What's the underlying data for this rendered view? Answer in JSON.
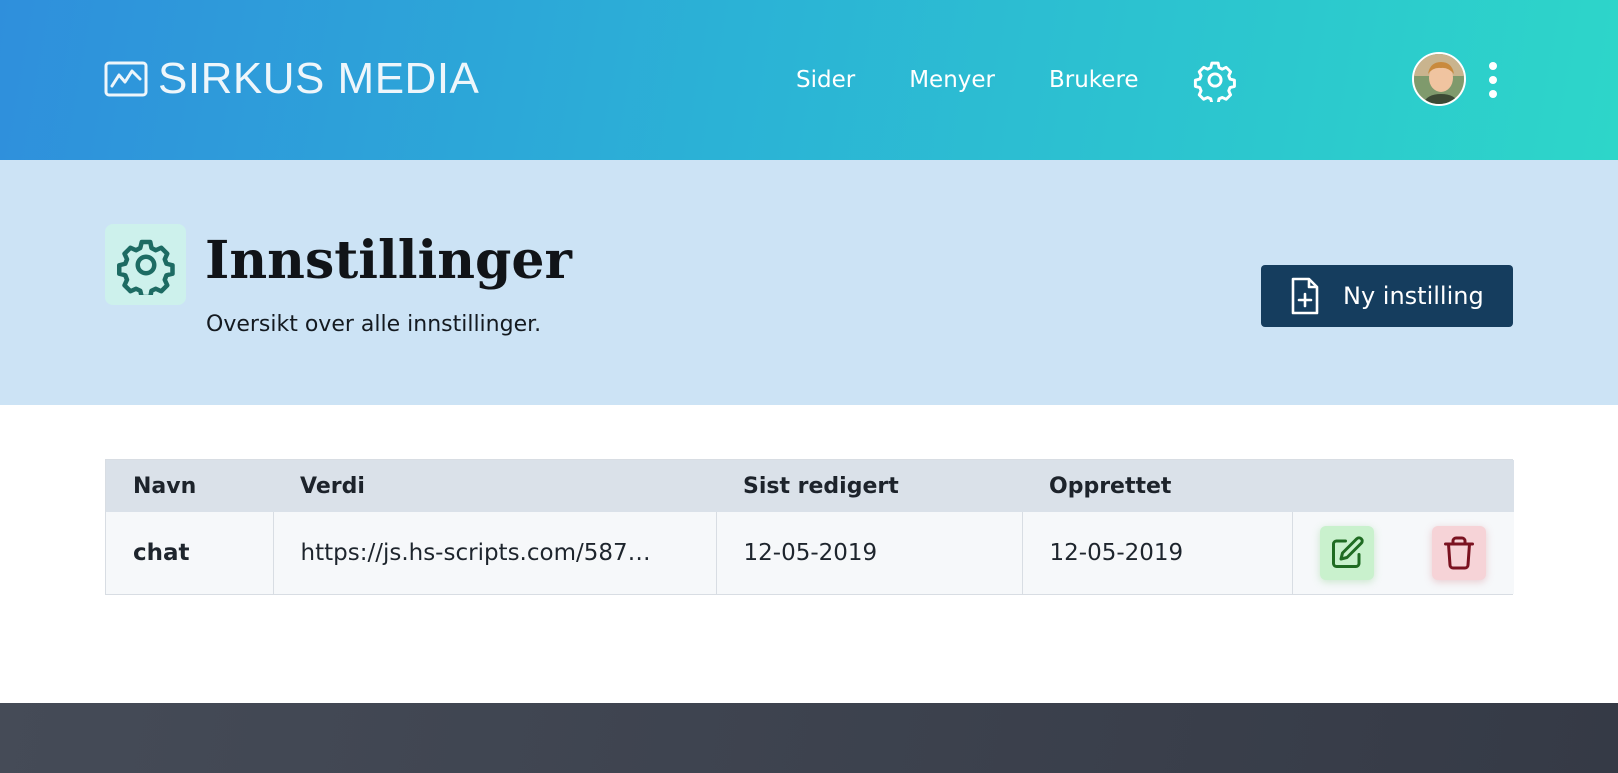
{
  "header": {
    "brand": "SIRKUS MEDIA",
    "logo_icon": "chart-line-icon",
    "nav": [
      {
        "label": "Sider"
      },
      {
        "label": "Menyer"
      },
      {
        "label": "Brukere"
      }
    ],
    "settings_icon": "gear-icon",
    "menu_icon": "kebab-menu-icon"
  },
  "hero": {
    "icon": "gear-icon",
    "title": "Innstillinger",
    "subtitle": "Oversikt over alle innstillinger.",
    "new_button_label": "Ny instilling",
    "new_button_icon": "file-plus-icon"
  },
  "table": {
    "columns": [
      "Navn",
      "Verdi",
      "Sist redigert",
      "Opprettet",
      ""
    ],
    "rows": [
      {
        "name": "chat",
        "value": "https://js.hs-scripts.com/587…",
        "edited": "12-05-2019",
        "created": "12-05-2019",
        "edit_icon": "edit-icon",
        "delete_icon": "trash-icon"
      }
    ]
  },
  "colors": {
    "header_gradient_start": "#2f8fdc",
    "header_gradient_end": "#2dd6c9",
    "hero_bg": "#cce3f5",
    "primary_button": "#153d5e",
    "edit_bg": "#c9f1cd",
    "delete_bg": "#f6d3d7",
    "footer_bg": "#3d424e"
  }
}
